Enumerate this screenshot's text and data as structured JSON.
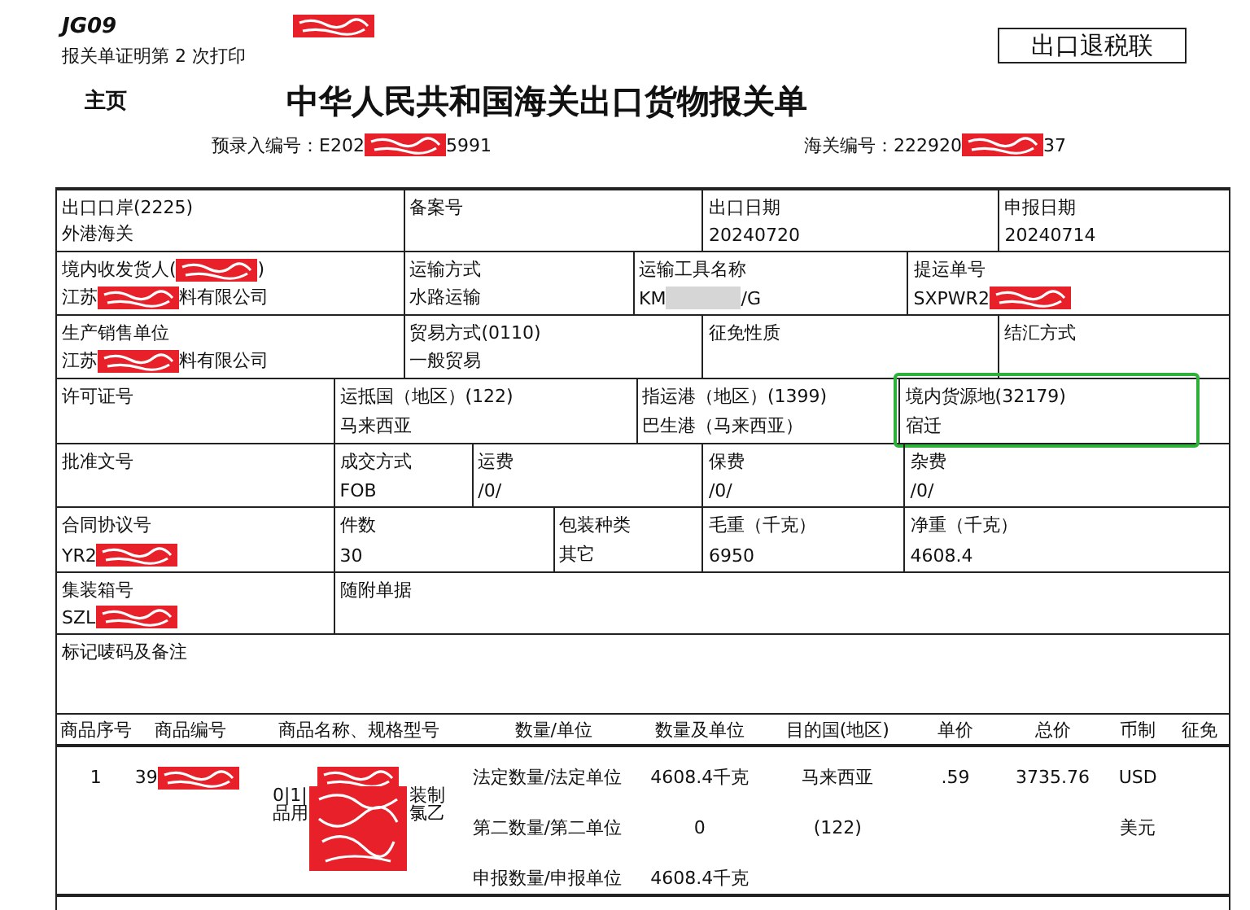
{
  "header": {
    "code": "JG09",
    "stamp": [
      {
        "kind": "redaction"
      }
    ],
    "print_note": "报关单证明第 2 次打印",
    "copy_label": "出口退税联",
    "home": "主页",
    "title": "中华人民共和国海关出口货物报关单",
    "pre_entry": [
      {
        "kind": "text",
        "text": "预录入编号：E202"
      },
      {
        "kind": "redaction"
      },
      {
        "kind": "text",
        "text": "5991"
      }
    ],
    "customs_no": [
      {
        "kind": "text",
        "text": "海关编号：222920"
      },
      {
        "kind": "redaction"
      },
      {
        "kind": "text",
        "text": "37"
      }
    ]
  },
  "rows": [
    {
      "cells": [
        {
          "label": [
            {
              "kind": "text",
              "text": "出口口岸(2225)"
            }
          ],
          "value": [
            {
              "kind": "text",
              "text": "外港海关"
            }
          ]
        },
        {
          "label": [
            {
              "kind": "text",
              "text": "备案号"
            }
          ]
        },
        {
          "label": [
            {
              "kind": "text",
              "text": "出口日期"
            }
          ],
          "value": [
            {
              "kind": "text",
              "text": "20240720"
            }
          ]
        },
        {
          "label": [
            {
              "kind": "text",
              "text": "申报日期"
            }
          ],
          "value": [
            {
              "kind": "text",
              "text": "20240714"
            }
          ]
        }
      ]
    },
    {
      "cells": [
        {
          "label": [
            {
              "kind": "text",
              "text": "境内收发货人("
            },
            {
              "kind": "redaction"
            },
            {
              "kind": "text",
              "text": ")"
            }
          ],
          "value": [
            {
              "kind": "text",
              "text": "江苏"
            },
            {
              "kind": "redaction"
            },
            {
              "kind": "text",
              "text": "料有限公司"
            }
          ]
        },
        {
          "label": [
            {
              "kind": "text",
              "text": "运输方式"
            }
          ],
          "value": [
            {
              "kind": "text",
              "text": "水路运输"
            }
          ]
        },
        {
          "label": [
            {
              "kind": "text",
              "text": "运输工具名称"
            }
          ],
          "value": [
            {
              "kind": "text",
              "text": "KM"
            },
            {
              "kind": "blur"
            },
            {
              "kind": "text",
              "text": "/G"
            }
          ]
        },
        {
          "label": [
            {
              "kind": "text",
              "text": "提运单号"
            }
          ],
          "value": [
            {
              "kind": "text",
              "text": "SXPWR2"
            },
            {
              "kind": "redaction"
            }
          ]
        }
      ]
    },
    {
      "cells": [
        {
          "label": [
            {
              "kind": "text",
              "text": "生产销售单位"
            }
          ],
          "value": [
            {
              "kind": "text",
              "text": "江苏"
            },
            {
              "kind": "redaction"
            },
            {
              "kind": "text",
              "text": "料有限公司"
            }
          ]
        },
        {
          "label": [
            {
              "kind": "text",
              "text": "贸易方式(0110)"
            }
          ],
          "value": [
            {
              "kind": "text",
              "text": "一般贸易"
            }
          ]
        },
        {
          "label": [
            {
              "kind": "text",
              "text": "征免性质"
            }
          ]
        },
        {
          "label": [
            {
              "kind": "text",
              "text": "结汇方式"
            }
          ]
        }
      ]
    },
    {
      "cells": [
        {
          "label": [
            {
              "kind": "text",
              "text": "许可证号"
            }
          ]
        },
        {
          "label": [
            {
              "kind": "text",
              "text": "运抵国（地区）(122)"
            }
          ],
          "value": [
            {
              "kind": "text",
              "text": "马来西亚"
            }
          ]
        },
        {
          "label": [
            {
              "kind": "text",
              "text": "指运港（地区）(1399)"
            }
          ],
          "value": [
            {
              "kind": "text",
              "text": "巴生港（马来西亚）"
            }
          ]
        },
        {
          "label": [
            {
              "kind": "text",
              "text": "境内货源地(32179)"
            }
          ],
          "value": [
            {
              "kind": "text",
              "text": "宿迁"
            }
          ],
          "highlighted": true
        }
      ]
    },
    {
      "cells": [
        {
          "label": [
            {
              "kind": "text",
              "text": "批准文号"
            }
          ]
        },
        {
          "label": [
            {
              "kind": "text",
              "text": "成交方式"
            }
          ],
          "value": [
            {
              "kind": "text",
              "text": "FOB"
            }
          ]
        },
        {
          "label": [
            {
              "kind": "text",
              "text": "运费"
            }
          ],
          "value": [
            {
              "kind": "text",
              "text": "/0/"
            }
          ]
        },
        {
          "label": [
            {
              "kind": "text",
              "text": "保费"
            }
          ],
          "value": [
            {
              "kind": "text",
              "text": "/0/"
            }
          ]
        },
        {
          "label": [
            {
              "kind": "text",
              "text": "杂费"
            }
          ],
          "value": [
            {
              "kind": "text",
              "text": "/0/"
            }
          ]
        }
      ]
    },
    {
      "cells": [
        {
          "label": [
            {
              "kind": "text",
              "text": "合同协议号"
            }
          ],
          "value": [
            {
              "kind": "text",
              "text": "YR2"
            },
            {
              "kind": "redaction"
            }
          ]
        },
        {
          "label": [
            {
              "kind": "text",
              "text": "件数"
            }
          ],
          "value": [
            {
              "kind": "text",
              "text": "30"
            }
          ]
        },
        {
          "label": [
            {
              "kind": "text",
              "text": "包装种类"
            }
          ],
          "value": [
            {
              "kind": "text",
              "text": "其它"
            }
          ]
        },
        {
          "label": [
            {
              "kind": "text",
              "text": "毛重（千克）"
            }
          ],
          "value": [
            {
              "kind": "text",
              "text": "6950"
            }
          ]
        },
        {
          "label": [
            {
              "kind": "text",
              "text": "净重（千克）"
            }
          ],
          "value": [
            {
              "kind": "text",
              "text": "4608.4"
            }
          ]
        }
      ]
    },
    {
      "cells": [
        {
          "label": [
            {
              "kind": "text",
              "text": "集装箱号"
            }
          ],
          "value": [
            {
              "kind": "text",
              "text": "SZL"
            },
            {
              "kind": "redaction"
            }
          ]
        },
        {
          "label": [
            {
              "kind": "text",
              "text": "随附单据"
            }
          ]
        }
      ]
    },
    {
      "cells": [
        {
          "label": [
            {
              "kind": "text",
              "text": "标记唛码及备注"
            }
          ]
        }
      ]
    }
  ],
  "goods": {
    "columns": [
      "商品序号",
      "商品编号",
      "商品名称、规格型号",
      "数量/单位",
      "数量及单位",
      "目的国(地区)",
      "单价",
      "总价",
      "币制",
      "征免"
    ],
    "lines": [
      {
        "seq": [
          {
            "kind": "text",
            "text": "1"
          }
        ],
        "code": [
          {
            "kind": "text",
            "text": "39"
          },
          {
            "kind": "redaction"
          }
        ],
        "name": [
          {
            "kind": "redaction"
          }
        ],
        "qty_label": [
          {
            "kind": "text",
            "text": "法定数量/法定单位"
          }
        ],
        "qty": [
          {
            "kind": "text",
            "text": "4608.4千克"
          }
        ],
        "destination": [
          {
            "kind": "text",
            "text": "马来西亚"
          }
        ],
        "unit_price": [
          {
            "kind": "text",
            "text": ".59"
          }
        ],
        "total": [
          {
            "kind": "text",
            "text": "3735.76"
          }
        ],
        "currency": [
          {
            "kind": "text",
            "text": "USD"
          }
        ]
      },
      {
        "name": [
          {
            "kind": "text",
            "text": "0|1|"
          },
          {
            "kind": "text",
            "text": "品用"
          },
          {
            "kind": "bigredaction"
          },
          {
            "kind": "text",
            "text": "装制"
          },
          {
            "kind": "text",
            "text": "氯乙"
          }
        ],
        "qty_label": [
          {
            "kind": "text",
            "text": "第二数量/第二单位"
          }
        ],
        "qty": [
          {
            "kind": "text",
            "text": "0"
          }
        ],
        "destination": [
          {
            "kind": "text",
            "text": "(122)"
          }
        ],
        "currency": [
          {
            "kind": "text",
            "text": "美元"
          }
        ]
      },
      {
        "qty_label": [
          {
            "kind": "text",
            "text": "申报数量/申报单位"
          }
        ],
        "qty": [
          {
            "kind": "text",
            "text": "4608.4千克"
          }
        ]
      }
    ]
  }
}
